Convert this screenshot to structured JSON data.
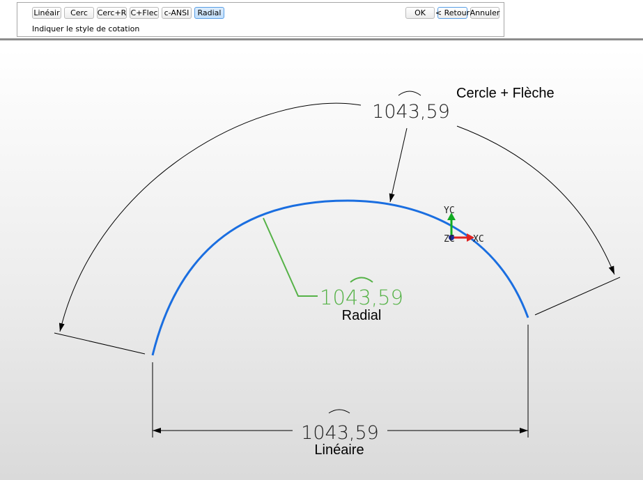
{
  "toolbar": {
    "style_buttons": [
      {
        "label": "Linéair",
        "active": false
      },
      {
        "label": "Cerc",
        "active": false
      },
      {
        "label": "Cerc+R",
        "active": false
      },
      {
        "label": "C+Flec",
        "active": false
      },
      {
        "label": "c-ANSI",
        "active": false
      },
      {
        "label": "Radial",
        "active": true
      }
    ],
    "ok_label": "OK",
    "back_label": "< Retour",
    "cancel_label": "Annuler",
    "prompt": "Indiquer le style de cotation"
  },
  "drawing": {
    "dim_value": "1043,59",
    "labels": {
      "cercle_fleche": "Cercle + Flèche",
      "radial": "Radial",
      "lineaire": "Linéaire"
    },
    "csys": {
      "y_axis": "YC",
      "x_axis": "XC",
      "z_axis": "ZC"
    },
    "colors": {
      "arc": "#1a6ee0",
      "radial_dimension": "#55b247",
      "dimension": "#000000",
      "csys_y": "#11aa22",
      "csys_x": "#dd2222",
      "csys_origin": "#1a2a9a"
    }
  }
}
